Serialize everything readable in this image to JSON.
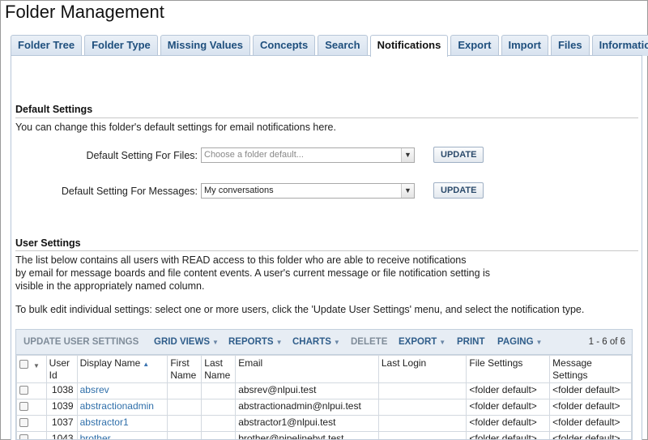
{
  "page": {
    "title": "Folder Management"
  },
  "tabs": [
    {
      "label": "Folder Tree",
      "active": false
    },
    {
      "label": "Folder Type",
      "active": false
    },
    {
      "label": "Missing Values",
      "active": false
    },
    {
      "label": "Concepts",
      "active": false
    },
    {
      "label": "Search",
      "active": false
    },
    {
      "label": "Notifications",
      "active": true
    },
    {
      "label": "Export",
      "active": false
    },
    {
      "label": "Import",
      "active": false
    },
    {
      "label": "Files",
      "active": false
    },
    {
      "label": "Information",
      "active": false
    }
  ],
  "default_settings": {
    "heading": "Default Settings",
    "description": "You can change this folder's default settings for email notifications here.",
    "files": {
      "label": "Default Setting For Files:",
      "placeholder": "Choose a folder default...",
      "value": "",
      "button": "UPDATE"
    },
    "messages": {
      "label": "Default Setting For Messages:",
      "value": "My conversations",
      "button": "UPDATE"
    }
  },
  "user_settings": {
    "heading": "User Settings",
    "line1": "The list below contains all users with READ access to this folder who are able to receive notifications",
    "line2": "by email for message boards and file content events. A user's current message or file notification setting is",
    "line3": "visible in the appropriately named column.",
    "bulk_hint": "To bulk edit individual settings: select one or more users, click the 'Update User Settings' menu, and select the notification type."
  },
  "grid": {
    "toolbar": {
      "update_user_settings": "UPDATE USER SETTINGS",
      "grid_views": "GRID VIEWS",
      "reports": "REPORTS",
      "charts": "CHARTS",
      "delete": "DELETE",
      "export": "EXPORT",
      "print": "PRINT",
      "paging": "PAGING",
      "count": "1 - 6 of 6"
    },
    "columns": {
      "user_id": "User Id",
      "display_name": "Display Name",
      "first_name": "First Name",
      "last_name": "Last Name",
      "email": "Email",
      "last_login": "Last Login",
      "file_settings": "File Settings",
      "message_settings": "Message Settings"
    },
    "rows": [
      {
        "user_id": "1038",
        "display_name": "absrev",
        "first_name": "",
        "last_name": "",
        "email": "absrev@nlpui.test",
        "last_login": "",
        "file_settings": "<folder default>",
        "message_settings": "<folder default>"
      },
      {
        "user_id": "1039",
        "display_name": "abstractionadmin",
        "first_name": "",
        "last_name": "",
        "email": "abstractionadmin@nlpui.test",
        "last_login": "",
        "file_settings": "<folder default>",
        "message_settings": "<folder default>"
      },
      {
        "user_id": "1037",
        "display_name": "abstractor1",
        "first_name": "",
        "last_name": "",
        "email": "abstractor1@nlpui.test",
        "last_login": "",
        "file_settings": "<folder default>",
        "message_settings": "<folder default>"
      },
      {
        "user_id": "1043",
        "display_name": "brother",
        "first_name": "",
        "last_name": "",
        "email": "brother@pipelinebvt.test",
        "last_login": "",
        "file_settings": "<folder default>",
        "message_settings": "<folder default>"
      }
    ]
  }
}
